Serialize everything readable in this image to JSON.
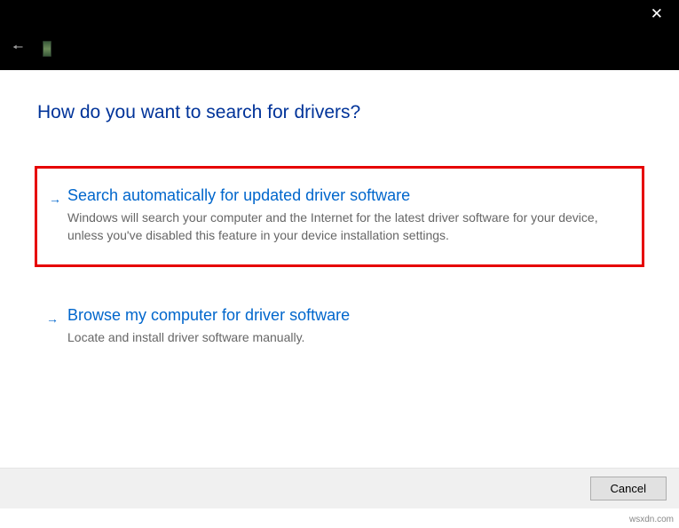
{
  "header": {
    "title": "How do you want to search for drivers?"
  },
  "options": [
    {
      "title": "Search automatically for updated driver software",
      "description": "Windows will search your computer and the Internet for the latest driver software for your device, unless you've disabled this feature in your device installation settings.",
      "highlighted": true
    },
    {
      "title": "Browse my computer for driver software",
      "description": "Locate and install driver software manually.",
      "highlighted": false
    }
  ],
  "footer": {
    "cancel_label": "Cancel"
  },
  "watermark": "wsxdn.com"
}
